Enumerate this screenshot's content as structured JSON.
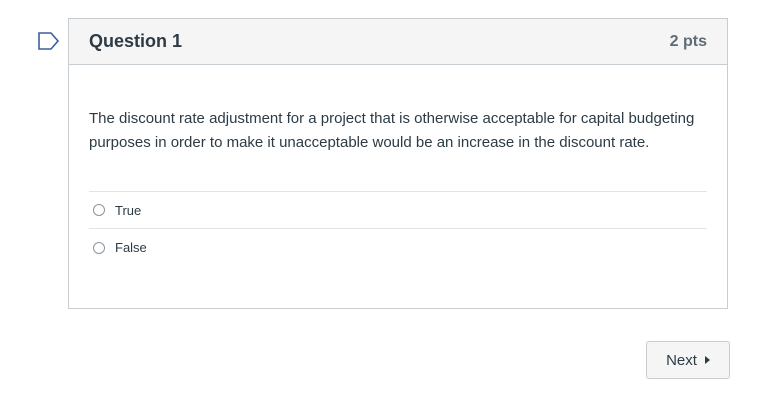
{
  "question": {
    "title": "Question 1",
    "points": "2 pts",
    "text": "The discount rate adjustment for a project that is otherwise acceptable for capital budgeting purposes in order to make it unacceptable would be an increase in the discount rate.",
    "answers": [
      {
        "label": "True"
      },
      {
        "label": "False"
      }
    ]
  },
  "navigation": {
    "next_label": "Next"
  },
  "icons": {
    "flag": "flag-outline-icon",
    "next_caret": "caret-right-icon"
  },
  "colors": {
    "accent_flag": "#3c5e9e",
    "border": "#c7cdd1",
    "header_bg": "#f5f5f5",
    "text": "#2d3b45"
  }
}
